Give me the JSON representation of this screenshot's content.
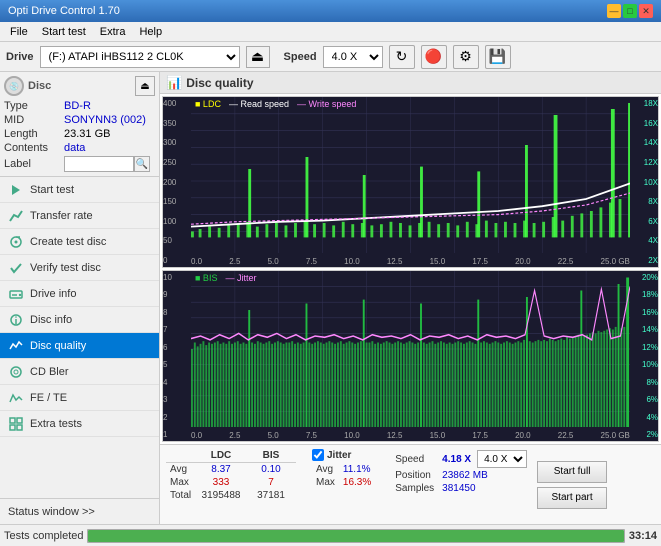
{
  "app": {
    "title": "Opti Drive Control 1.70",
    "version": "1.70"
  },
  "title_bar": {
    "text": "Opti Drive Control 1.70",
    "min_btn": "—",
    "max_btn": "□",
    "close_btn": "✕"
  },
  "menu": {
    "items": [
      "File",
      "Start test",
      "Extra",
      "Help"
    ]
  },
  "drive_bar": {
    "label": "Drive",
    "drive_value": "(F:) ATAPI iHBS112  2 CL0K",
    "speed_label": "Speed",
    "speed_value": "4.0 X",
    "eject_symbol": "⏏"
  },
  "disc": {
    "header": "Disc",
    "type_label": "Type",
    "type_value": "BD-R",
    "mid_label": "MID",
    "mid_value": "SONYNN3 (002)",
    "length_label": "Length",
    "length_value": "23.31 GB",
    "contents_label": "Contents",
    "contents_value": "data",
    "label_label": "Label",
    "label_value": ""
  },
  "nav": {
    "items": [
      {
        "id": "start-test",
        "label": "Start test",
        "icon": "play"
      },
      {
        "id": "transfer-rate",
        "label": "Transfer rate",
        "icon": "chart-line"
      },
      {
        "id": "create-test-disc",
        "label": "Create test disc",
        "icon": "disc"
      },
      {
        "id": "verify-test-disc",
        "label": "Verify test disc",
        "icon": "check"
      },
      {
        "id": "drive-info",
        "label": "Drive info",
        "icon": "info"
      },
      {
        "id": "disc-info",
        "label": "Disc info",
        "icon": "disc-info"
      },
      {
        "id": "disc-quality",
        "label": "Disc quality",
        "icon": "quality",
        "active": true
      },
      {
        "id": "cd-bler",
        "label": "CD Bler",
        "icon": "cd"
      },
      {
        "id": "fe-te",
        "label": "FE / TE",
        "icon": "fe"
      },
      {
        "id": "extra-tests",
        "label": "Extra tests",
        "icon": "extra"
      }
    ],
    "status_window": "Status window >>"
  },
  "disc_quality": {
    "title": "Disc quality",
    "chart1": {
      "title": "LDC",
      "legend": [
        {
          "label": "LDC",
          "color": "#ffff00"
        },
        {
          "label": "Read speed",
          "color": "#ffffff"
        },
        {
          "label": "Write speed",
          "color": "#ff44ff"
        }
      ],
      "y_max": 400,
      "y_labels_left": [
        "400",
        "350",
        "300",
        "250",
        "200",
        "150",
        "100",
        "50",
        "0"
      ],
      "y_labels_right": [
        "18X",
        "16X",
        "14X",
        "12X",
        "10X",
        "8X",
        "6X",
        "4X",
        "2X"
      ],
      "x_labels": [
        "0.0",
        "2.5",
        "5.0",
        "7.5",
        "10.0",
        "12.5",
        "15.0",
        "17.5",
        "20.0",
        "22.5",
        "25.0 GB"
      ]
    },
    "chart2": {
      "title": "BIS",
      "legend": [
        {
          "label": "BIS",
          "color": "#00ff44"
        },
        {
          "label": "Jitter",
          "color": "#ff88ff"
        }
      ],
      "y_max": 10,
      "y_labels_left": [
        "10",
        "9",
        "8",
        "7",
        "6",
        "5",
        "4",
        "3",
        "2",
        "1"
      ],
      "y_labels_right": [
        "20%",
        "18%",
        "16%",
        "14%",
        "12%",
        "10%",
        "8%",
        "6%",
        "4%",
        "2%"
      ],
      "x_labels": [
        "0.0",
        "2.5",
        "5.0",
        "7.5",
        "10.0",
        "12.5",
        "15.0",
        "17.5",
        "20.0",
        "22.5",
        "25.0 GB"
      ]
    }
  },
  "stats": {
    "columns": [
      "LDC",
      "BIS",
      "",
      "Jitter",
      "Speed",
      ""
    ],
    "rows": [
      {
        "label": "Avg",
        "ldc": "8.37",
        "bis": "0.10",
        "jitter": "11.1%",
        "speed_label": "Position",
        "speed_val": "23862 MB"
      },
      {
        "label": "Max",
        "ldc": "333",
        "bis": "7",
        "jitter": "16.3%",
        "speed_label": "Samples",
        "speed_val": "381450"
      },
      {
        "label": "Total",
        "ldc": "3195488",
        "bis": "37181",
        "jitter": "",
        "speed_label": "",
        "speed_val": ""
      }
    ],
    "speed_display": "4.18 X",
    "speed_select": "4.0 X",
    "start_full_btn": "Start full",
    "start_part_btn": "Start part",
    "jitter_checked": true,
    "jitter_label": "Jitter"
  },
  "status_bar": {
    "text": "Tests completed",
    "progress": 100,
    "time": "33:14"
  },
  "colors": {
    "accent": "#0078d4",
    "active_nav": "#0078d4",
    "ldc_color": "#ffff00",
    "bis_color": "#00ee44",
    "jitter_color": "#ff88ff",
    "read_speed_color": "#ffffff",
    "write_speed_color": "#ff44ff",
    "chart_bg": "#1a1a2e",
    "grid_color": "#333355"
  }
}
